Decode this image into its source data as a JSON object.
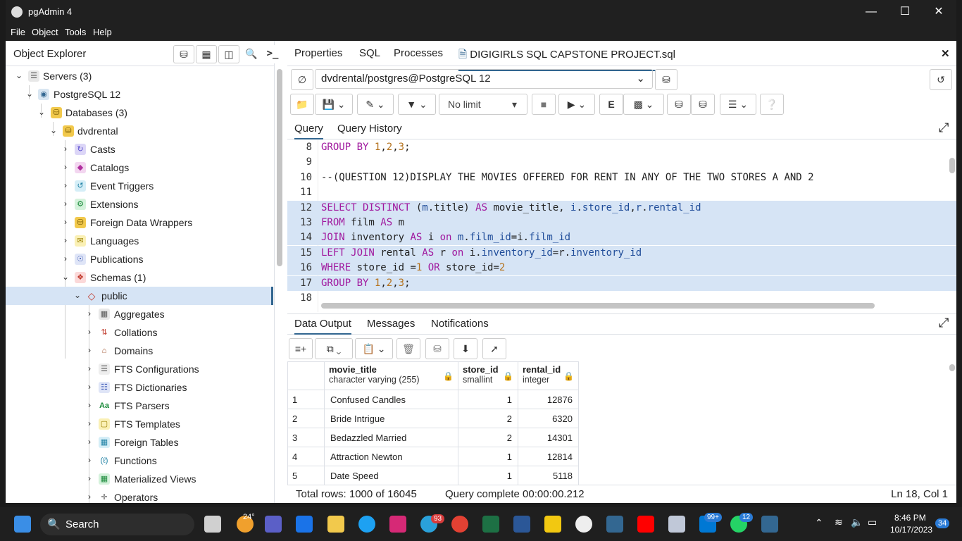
{
  "window": {
    "title": "pgAdmin 4"
  },
  "menu": [
    "File",
    "Object",
    "Tools",
    "Help"
  ],
  "object_explorer": {
    "title": "Object Explorer",
    "tree": [
      {
        "label": "Servers (3)",
        "icon": "servers-icon"
      },
      {
        "label": "PostgreSQL 12",
        "icon": "elephant-icon"
      },
      {
        "label": "Databases (3)",
        "icon": "databases-icon"
      },
      {
        "label": "dvdrental",
        "icon": "database-icon"
      },
      {
        "label": "Casts",
        "icon": "casts-icon"
      },
      {
        "label": "Catalogs",
        "icon": "catalogs-icon"
      },
      {
        "label": "Event Triggers",
        "icon": "event-triggers-icon"
      },
      {
        "label": "Extensions",
        "icon": "extensions-icon"
      },
      {
        "label": "Foreign Data Wrappers",
        "icon": "fdw-icon"
      },
      {
        "label": "Languages",
        "icon": "languages-icon"
      },
      {
        "label": "Publications",
        "icon": "publications-icon"
      },
      {
        "label": "Schemas (1)",
        "icon": "schemas-icon"
      },
      {
        "label": "public",
        "icon": "schema-icon"
      },
      {
        "label": "Aggregates",
        "icon": "aggregates-icon"
      },
      {
        "label": "Collations",
        "icon": "collations-icon"
      },
      {
        "label": "Domains",
        "icon": "domains-icon"
      },
      {
        "label": "FTS Configurations",
        "icon": "fts-config-icon"
      },
      {
        "label": "FTS Dictionaries",
        "icon": "fts-dict-icon"
      },
      {
        "label": "FTS Parsers",
        "icon": "fts-parser-icon"
      },
      {
        "label": "FTS Templates",
        "icon": "fts-template-icon"
      },
      {
        "label": "Foreign Tables",
        "icon": "foreign-table-icon"
      },
      {
        "label": "Functions",
        "icon": "function-icon"
      },
      {
        "label": "Materialized Views",
        "icon": "matview-icon"
      },
      {
        "label": "Operators",
        "icon": "operator-icon"
      }
    ]
  },
  "tabs": {
    "properties": "Properties",
    "sql": "SQL",
    "processes": "Processes",
    "file": "DIGIGIRLS SQL CAPSTONE PROJECT.sql"
  },
  "connection": "dvdrental/postgres@PostgreSQL 12",
  "toolbar": {
    "limit": "No limit"
  },
  "query_tabs": {
    "query": "Query",
    "history": "Query History"
  },
  "editor": {
    "lines": [
      {
        "n": "8",
        "text": "GROUP BY 1,2,3;"
      },
      {
        "n": "9",
        "text": ""
      },
      {
        "n": "10",
        "text": "--(QUESTION 12)DISPLAY THE MOVIES OFFERED FOR RENT IN ANY OF THE TWO STORES A AND 2"
      },
      {
        "n": "11",
        "text": ""
      },
      {
        "n": "12",
        "text": "SELECT DISTINCT (m.title) AS movie_title, i.store_id,r.rental_id"
      },
      {
        "n": "13",
        "text": "FROM film AS m"
      },
      {
        "n": "14",
        "text": "JOIN inventory AS i on m.film_id=i.film_id"
      },
      {
        "n": "15",
        "text": "LEFT JOIN rental AS r on i.inventory_id=r.inventory_id"
      },
      {
        "n": "16",
        "text": "WHERE store_id =1 OR store_id=2"
      },
      {
        "n": "17",
        "text": "GROUP BY 1,2,3;"
      },
      {
        "n": "18",
        "text": ""
      }
    ]
  },
  "output_tabs": {
    "data": "Data Output",
    "messages": "Messages",
    "notifications": "Notifications"
  },
  "grid": {
    "columns": [
      {
        "name": "movie_title",
        "type": "character varying (255)"
      },
      {
        "name": "store_id",
        "type": "smallint"
      },
      {
        "name": "rental_id",
        "type": "integer"
      }
    ],
    "rows": [
      {
        "n": "1",
        "title": "Confused Candles",
        "store": "1",
        "rental": "12876"
      },
      {
        "n": "2",
        "title": "Bride Intrigue",
        "store": "2",
        "rental": "6320"
      },
      {
        "n": "3",
        "title": "Bedazzled Married",
        "store": "2",
        "rental": "14301"
      },
      {
        "n": "4",
        "title": "Attraction Newton",
        "store": "1",
        "rental": "12814"
      },
      {
        "n": "5",
        "title": "Date Speed",
        "store": "1",
        "rental": "5118"
      }
    ]
  },
  "status": {
    "rows": "Total rows: 1000 of 16045",
    "time": "Query complete 00:00:00.212",
    "cursor": "Ln 18, Col 1"
  },
  "taskbar": {
    "search": "Search",
    "weather": "24°",
    "telegram_badge": "93",
    "mail_badge": "99+",
    "whatsapp_badge": "12",
    "time": "8:46 PM",
    "date": "10/17/2023",
    "notif_count": "34"
  }
}
